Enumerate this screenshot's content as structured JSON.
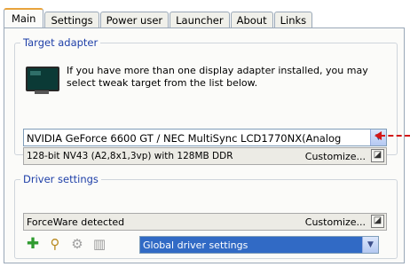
{
  "tabs": [
    "Main",
    "Settings",
    "Power user",
    "Launcher",
    "About",
    "Links"
  ],
  "target_adapter": {
    "legend": "Target adapter",
    "description": "If you have more than one display adapter installed, you may select tweak target from the list below.",
    "adapter_value": "NVIDIA GeForce 6600 GT / NEC MultiSync LCD1770NX(Analog",
    "info_text": "128-bit NV43 (A2,8x1,3vp) with 128MB DDR",
    "customize_label": "Customize..."
  },
  "driver_settings": {
    "legend": "Driver settings",
    "info_text": "ForceWare detected",
    "customize_label": "Customize...",
    "profile_value": "Global driver settings"
  },
  "icons": {
    "monitor": "monitor-icon",
    "add": "add-icon",
    "search": "search-icon",
    "settings": "gear-icon",
    "delete": "trash-icon",
    "tweak": "tweak-icon",
    "dropdown": "chevron-down-icon"
  },
  "colors": {
    "accent": "#316ac5",
    "legend": "#1e3fa8",
    "annotation": "#d31818",
    "tab_highlight": "#e8a33c"
  }
}
